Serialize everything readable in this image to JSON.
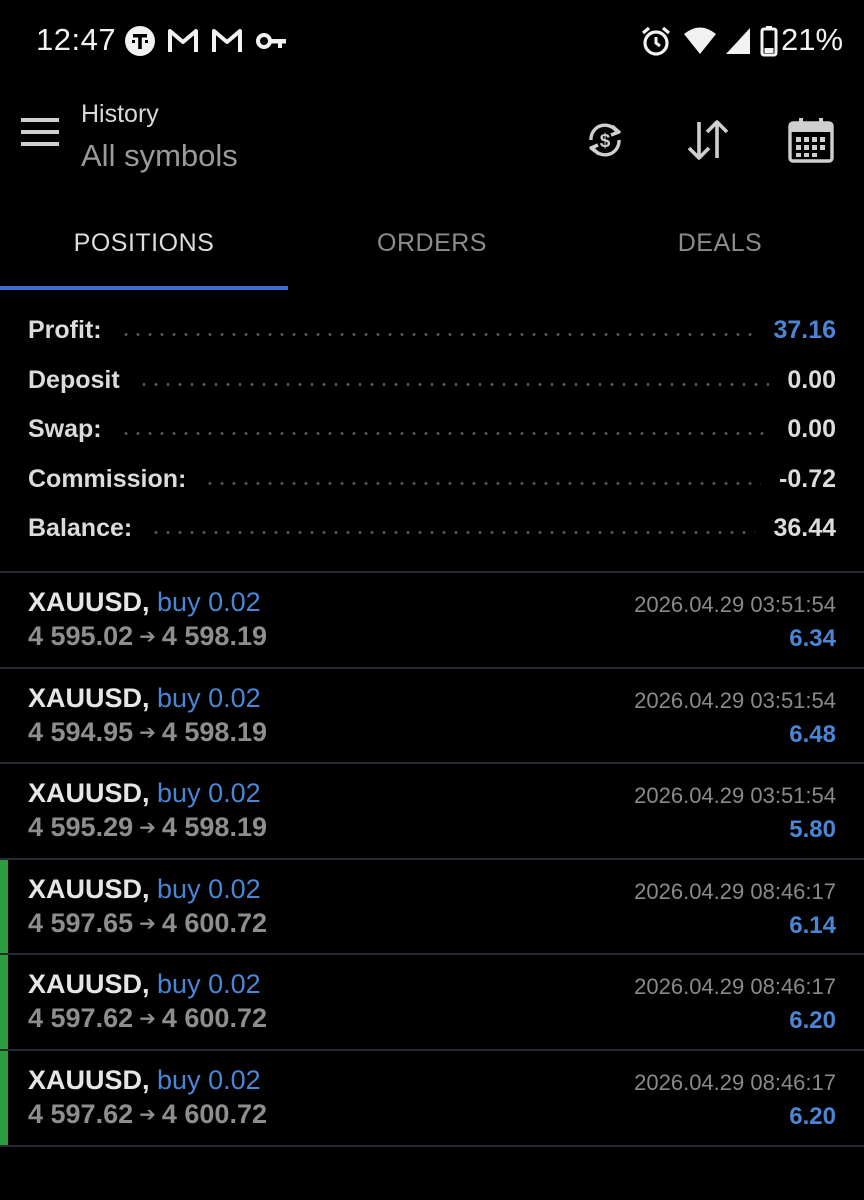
{
  "status_bar": {
    "time": "12:47",
    "battery": "21%",
    "left_icons": [
      "t-mobile-icon",
      "gmail-icon",
      "gmail-icon",
      "vpn-key-icon"
    ],
    "right_icons": [
      "alarm-icon",
      "wifi-icon",
      "signal-icon",
      "battery-icon"
    ]
  },
  "toolbar": {
    "title": "History",
    "subtitle": "All symbols"
  },
  "tabs": [
    {
      "label": "POSITIONS",
      "active": true
    },
    {
      "label": "ORDERS",
      "active": false
    },
    {
      "label": "DEALS",
      "active": false
    }
  ],
  "summary": [
    {
      "label": "Profit:",
      "value": "37.16"
    },
    {
      "label": "Deposit",
      "value": "0.00"
    },
    {
      "label": "Swap:",
      "value": "0.00"
    },
    {
      "label": "Commission:",
      "value": "-0.72"
    },
    {
      "label": "Balance:",
      "value": "36.44"
    }
  ],
  "positions": [
    {
      "symbol": "XAUUSD,",
      "side": "buy 0.02",
      "open": "4 595.02",
      "arrow": "➔",
      "close": "4 598.19",
      "time": "2026.04.29 03:51:54",
      "profit": "6.34"
    },
    {
      "symbol": "XAUUSD,",
      "side": "buy 0.02",
      "open": "4 594.95",
      "arrow": "➔",
      "close": "4 598.19",
      "time": "2026.04.29 03:51:54",
      "profit": "6.48"
    },
    {
      "symbol": "XAUUSD,",
      "side": "buy 0.02",
      "open": "4 595.29",
      "arrow": "➔",
      "close": "4 598.19",
      "time": "2026.04.29 03:51:54",
      "profit": "5.80"
    },
    {
      "symbol": "XAUUSD,",
      "side": "buy 0.02",
      "open": "4 597.65",
      "arrow": "➔",
      "close": "4 600.72",
      "time": "2026.04.29 08:46:17",
      "profit": "6.14"
    },
    {
      "symbol": "XAUUSD,",
      "side": "buy 0.02",
      "open": "4 597.62",
      "arrow": "➔",
      "close": "4 600.72",
      "time": "2026.04.29 08:46:17",
      "profit": "6.20"
    },
    {
      "symbol": "XAUUSD,",
      "side": "buy 0.02",
      "open": "4 597.62",
      "arrow": "➔",
      "close": "4 600.72",
      "time": "2026.04.29 08:46:17",
      "profit": "6.20"
    }
  ],
  "colors": {
    "accent": "#4a86d6",
    "tab_indicator": "#3c6fd0",
    "row_marker": "#2f9b3f",
    "background": "#000000"
  }
}
